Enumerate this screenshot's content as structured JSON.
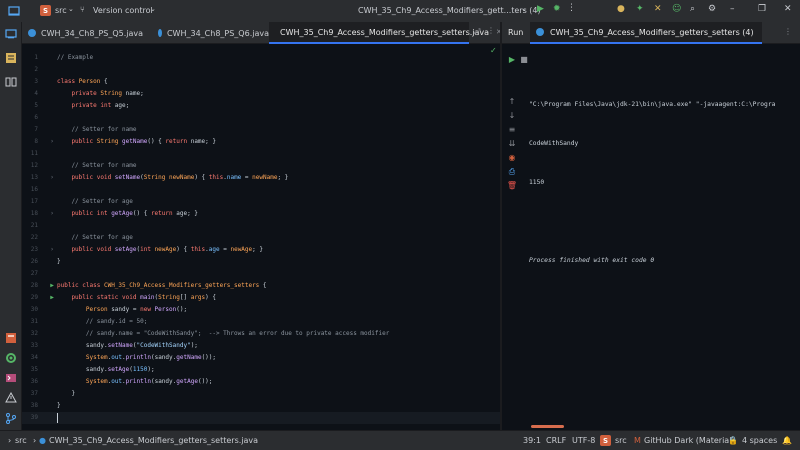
{
  "titlebar": {
    "project_badge": "S",
    "project_name": "src",
    "vcs_label": "Version control",
    "run_config": "CWH_35_Ch9_Access_Modifiers_gett...ters (4)"
  },
  "editor": {
    "tabs": [
      {
        "label": "CWH_34_Ch8_PS_Q5.java"
      },
      {
        "label": "CWH_34_Ch8_PS_Q6.java"
      },
      {
        "label": "CWH_35_Ch9_Access_Modifiers_getters_setters.java",
        "active": true
      }
    ],
    "lines": [
      {
        "n": "1",
        "tokens": [
          [
            "comment",
            "// Example"
          ]
        ]
      },
      {
        "n": "2",
        "tokens": []
      },
      {
        "n": "3",
        "tokens": [
          [
            "keyword",
            "class "
          ],
          [
            "type",
            "Person"
          ],
          [
            "punct",
            " {"
          ]
        ]
      },
      {
        "n": "4",
        "tokens": [
          [
            "keyword",
            "    private "
          ],
          [
            "type",
            "String "
          ],
          [
            "plain",
            "name;"
          ]
        ]
      },
      {
        "n": "5",
        "tokens": [
          [
            "keyword",
            "    private int "
          ],
          [
            "plain",
            "age;"
          ]
        ]
      },
      {
        "n": "6",
        "tokens": []
      },
      {
        "n": "7",
        "tokens": [
          [
            "comment",
            "    // Setter for name"
          ]
        ]
      },
      {
        "n": "8",
        "fold": true,
        "tokens": [
          [
            "keyword",
            "    public "
          ],
          [
            "type",
            "String "
          ],
          [
            "func",
            "getName"
          ],
          [
            "punct",
            "() { "
          ],
          [
            "keyword",
            "return "
          ],
          [
            "plain",
            "name; }"
          ]
        ]
      },
      {
        "n": "11",
        "tokens": []
      },
      {
        "n": "12",
        "tokens": [
          [
            "comment",
            "    // Setter for name"
          ]
        ]
      },
      {
        "n": "13",
        "fold": true,
        "tokens": [
          [
            "keyword",
            "    public void "
          ],
          [
            "func",
            "setName"
          ],
          [
            "punct",
            "("
          ],
          [
            "type",
            "String "
          ],
          [
            "param",
            "newName"
          ],
          [
            "punct",
            ") { "
          ],
          [
            "this",
            "this"
          ],
          [
            "punct",
            "."
          ],
          [
            "field",
            "name"
          ],
          [
            "punct",
            " = "
          ],
          [
            "param",
            "newName"
          ],
          [
            "punct",
            "; }"
          ]
        ]
      },
      {
        "n": "16",
        "tokens": []
      },
      {
        "n": "17",
        "tokens": [
          [
            "comment",
            "    // Setter for age"
          ]
        ]
      },
      {
        "n": "18",
        "fold": true,
        "tokens": [
          [
            "keyword",
            "    public int "
          ],
          [
            "func",
            "getAge"
          ],
          [
            "punct",
            "() { "
          ],
          [
            "keyword",
            "return "
          ],
          [
            "plain",
            "age; }"
          ]
        ]
      },
      {
        "n": "21",
        "tokens": []
      },
      {
        "n": "22",
        "tokens": [
          [
            "comment",
            "    // Setter for age"
          ]
        ]
      },
      {
        "n": "23",
        "fold": true,
        "tokens": [
          [
            "keyword",
            "    public void "
          ],
          [
            "func",
            "setAge"
          ],
          [
            "punct",
            "("
          ],
          [
            "keyword",
            "int "
          ],
          [
            "param",
            "newAge"
          ],
          [
            "punct",
            ") { "
          ],
          [
            "this",
            "this"
          ],
          [
            "punct",
            "."
          ],
          [
            "field",
            "age"
          ],
          [
            "punct",
            " = "
          ],
          [
            "param",
            "newAge"
          ],
          [
            "punct",
            "; }"
          ]
        ]
      },
      {
        "n": "26",
        "tokens": [
          [
            "punct",
            "}"
          ]
        ]
      },
      {
        "n": "27",
        "tokens": []
      },
      {
        "n": "28",
        "run": true,
        "tokens": [
          [
            "keyword",
            "public class "
          ],
          [
            "type",
            "CWH_35_Ch9_Access_Modifiers_getters_setters"
          ],
          [
            "punct",
            " {"
          ]
        ]
      },
      {
        "n": "29",
        "run": true,
        "tokens": [
          [
            "keyword",
            "    public static void "
          ],
          [
            "func",
            "main"
          ],
          [
            "punct",
            "("
          ],
          [
            "type",
            "String"
          ],
          [
            "punct",
            "[] "
          ],
          [
            "param",
            "args"
          ],
          [
            "punct",
            ") {"
          ]
        ]
      },
      {
        "n": "30",
        "tokens": [
          [
            "type",
            "        Person "
          ],
          [
            "plain",
            "sandy = "
          ],
          [
            "keyword",
            "new "
          ],
          [
            "func",
            "Person"
          ],
          [
            "punct",
            "();"
          ]
        ]
      },
      {
        "n": "31",
        "tokens": [
          [
            "comment",
            "        // sandy.id = 50;"
          ]
        ]
      },
      {
        "n": "32",
        "tokens": [
          [
            "comment",
            "        // sandy.name = \"CodeWithSandy\";  --> Throws an error due to private access modifier"
          ]
        ]
      },
      {
        "n": "33",
        "tokens": [
          [
            "plain",
            "        sandy."
          ],
          [
            "func",
            "setName"
          ],
          [
            "punct",
            "("
          ],
          [
            "string",
            "\"CodeWithSandy\""
          ],
          [
            "punct",
            ");"
          ]
        ]
      },
      {
        "n": "34",
        "tokens": [
          [
            "type",
            "        System"
          ],
          [
            "punct",
            "."
          ],
          [
            "field",
            "out"
          ],
          [
            "punct",
            "."
          ],
          [
            "func",
            "println"
          ],
          [
            "punct",
            "(sandy."
          ],
          [
            "func",
            "getName"
          ],
          [
            "punct",
            "());"
          ]
        ]
      },
      {
        "n": "35",
        "tokens": [
          [
            "plain",
            "        sandy."
          ],
          [
            "func",
            "setAge"
          ],
          [
            "punct",
            "("
          ],
          [
            "number",
            "1150"
          ],
          [
            "punct",
            ");"
          ]
        ]
      },
      {
        "n": "36",
        "tokens": [
          [
            "type",
            "        System"
          ],
          [
            "punct",
            "."
          ],
          [
            "field",
            "out"
          ],
          [
            "punct",
            "."
          ],
          [
            "func",
            "println"
          ],
          [
            "punct",
            "(sandy."
          ],
          [
            "func",
            "getAge"
          ],
          [
            "punct",
            "());"
          ]
        ]
      },
      {
        "n": "37",
        "tokens": [
          [
            "punct",
            "    }"
          ]
        ]
      },
      {
        "n": "38",
        "tokens": [
          [
            "punct",
            "}"
          ]
        ]
      },
      {
        "n": "39",
        "current": true,
        "tokens": []
      }
    ]
  },
  "run": {
    "title": "Run",
    "tab_label": "CWH_35_Ch9_Access_Modifiers_getters_setters (4)",
    "console": {
      "command": "\"C:\\Program Files\\Java\\jdk-21\\bin\\java.exe\" \"-javaagent:C:\\Progra",
      "output_1": "CodeWithSandy",
      "output_2": "1150",
      "exit": "Process finished with exit code 0"
    }
  },
  "statusbar": {
    "breadcrumb_root": "src",
    "breadcrumb_file": "CWH_35_Ch9_Access_Modifiers_getters_setters.java",
    "position": "39:1",
    "line_sep": "CRLF",
    "encoding": "UTF-8",
    "module_badge": "S",
    "module": "src",
    "theme": "GitHub Dark (Material)",
    "indent": "4 spaces"
  }
}
